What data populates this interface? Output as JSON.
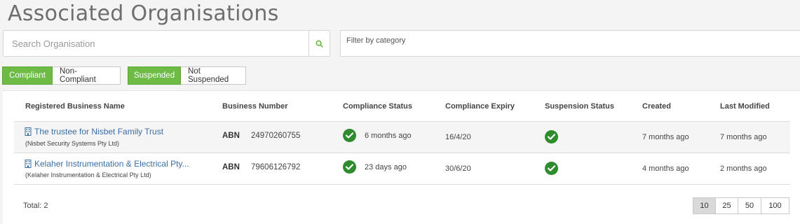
{
  "page": {
    "title": "Associated Organisations"
  },
  "search": {
    "placeholder": "Search Organisation",
    "value": ""
  },
  "filter": {
    "placeholder": "Filter by category"
  },
  "compliance_toggle": {
    "compliant": "Compliant",
    "non_compliant": "Non-Compliant",
    "active": "Compliant"
  },
  "suspension_toggle": {
    "suspended": "Suspended",
    "not_suspended": "Not Suspended",
    "active": "Suspended"
  },
  "table": {
    "headers": {
      "name": "Registered Business Name",
      "number": "Business Number",
      "compliance_status": "Compliance Status",
      "compliance_expiry": "Compliance Expiry",
      "suspension_status": "Suspension Status",
      "created": "Created",
      "last_modified": "Last Modified"
    },
    "rows": [
      {
        "name": "The trustee for Nisbet Family Trust",
        "subname": "(Nisbet Security Systems Pty Ltd)",
        "number_type": "ABN",
        "number": "24970260755",
        "compliance_time": "6 months ago",
        "compliance_expiry": "16/4/20",
        "created": "7 months ago",
        "last_modified": "7 months ago"
      },
      {
        "name": "Kelaher Instrumentation & Electrical Pty...",
        "subname": "(Kelaher Instrumentation & Electrical Pty Ltd)",
        "number_type": "ABN",
        "number": "79606126792",
        "compliance_time": "23 days ago",
        "compliance_expiry": "30/6/20",
        "created": "4 months ago",
        "last_modified": "2 months ago"
      }
    ]
  },
  "footer": {
    "total": "Total: 2",
    "page_sizes": [
      "10",
      "25",
      "50",
      "100"
    ],
    "active_page_size": "10"
  },
  "colors": {
    "accent": "#6dbb45",
    "check": "#2e8b2e",
    "link": "#3a6ea5"
  },
  "icons": {
    "search": "search-icon",
    "building": "building-icon",
    "check": "check-circle-icon"
  }
}
